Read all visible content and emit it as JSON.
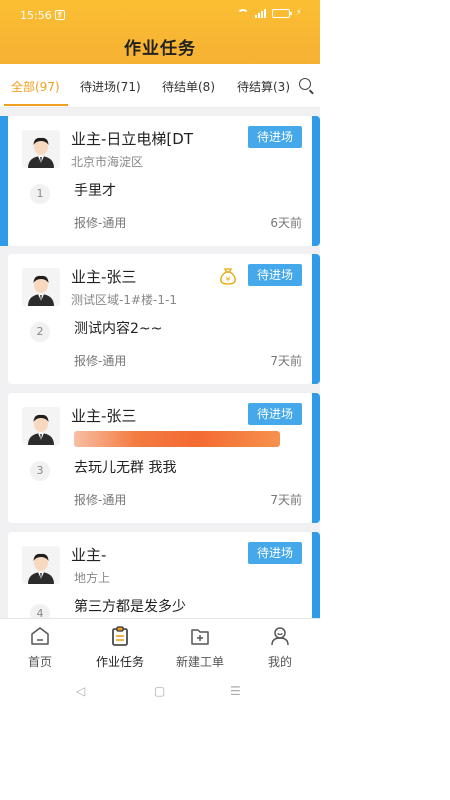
{
  "status_bar": {
    "time": "15:56",
    "notification_glyph": "❡",
    "charge_glyph": "⚡"
  },
  "header": {
    "title": "作业任务"
  },
  "tabs": [
    {
      "label": "全部(97)",
      "active": true
    },
    {
      "label": "待进场(71)",
      "active": false
    },
    {
      "label": "待结单(8)",
      "active": false
    },
    {
      "label": "待结算(3)",
      "active": false
    }
  ],
  "cards": [
    {
      "owner": "业主-日立电梯[DT",
      "location": "北京市海淀区",
      "index": "1",
      "content": "手里才",
      "category": "报修-通用",
      "time_ago": "6天前",
      "status": "待进场"
    },
    {
      "owner": "业主-张三",
      "location": "测试区域-1#楼-1-1",
      "index": "2",
      "content": "测试内容2~~",
      "category": "报修-通用",
      "time_ago": "7天前",
      "status": "待进场",
      "money_icon": "money-bag-icon"
    },
    {
      "owner": "业主-张三",
      "location": "",
      "index": "3",
      "content": "去玩儿无群 我我",
      "category": "报修-通用",
      "time_ago": "7天前",
      "status": "待进场"
    },
    {
      "owner": "业主-",
      "location": "地方上",
      "index": "4",
      "content": "第三方都是发多少",
      "status": "待进场"
    }
  ],
  "bottom_nav": [
    {
      "label": "首页",
      "icon": "home-icon",
      "active": false
    },
    {
      "label": "作业任务",
      "icon": "task-clipboard-icon",
      "active": true
    },
    {
      "label": "新建工单",
      "icon": "new-order-icon",
      "active": false
    },
    {
      "label": "我的",
      "icon": "profile-icon",
      "active": false
    }
  ],
  "system_nav": {
    "back": "◁",
    "home": "▢",
    "menu": "☰"
  },
  "colors": {
    "accent": "#f0a020",
    "header": "#fbbf33",
    "status_button": "#45a8ea",
    "card_edge": "#2e9ae8"
  }
}
